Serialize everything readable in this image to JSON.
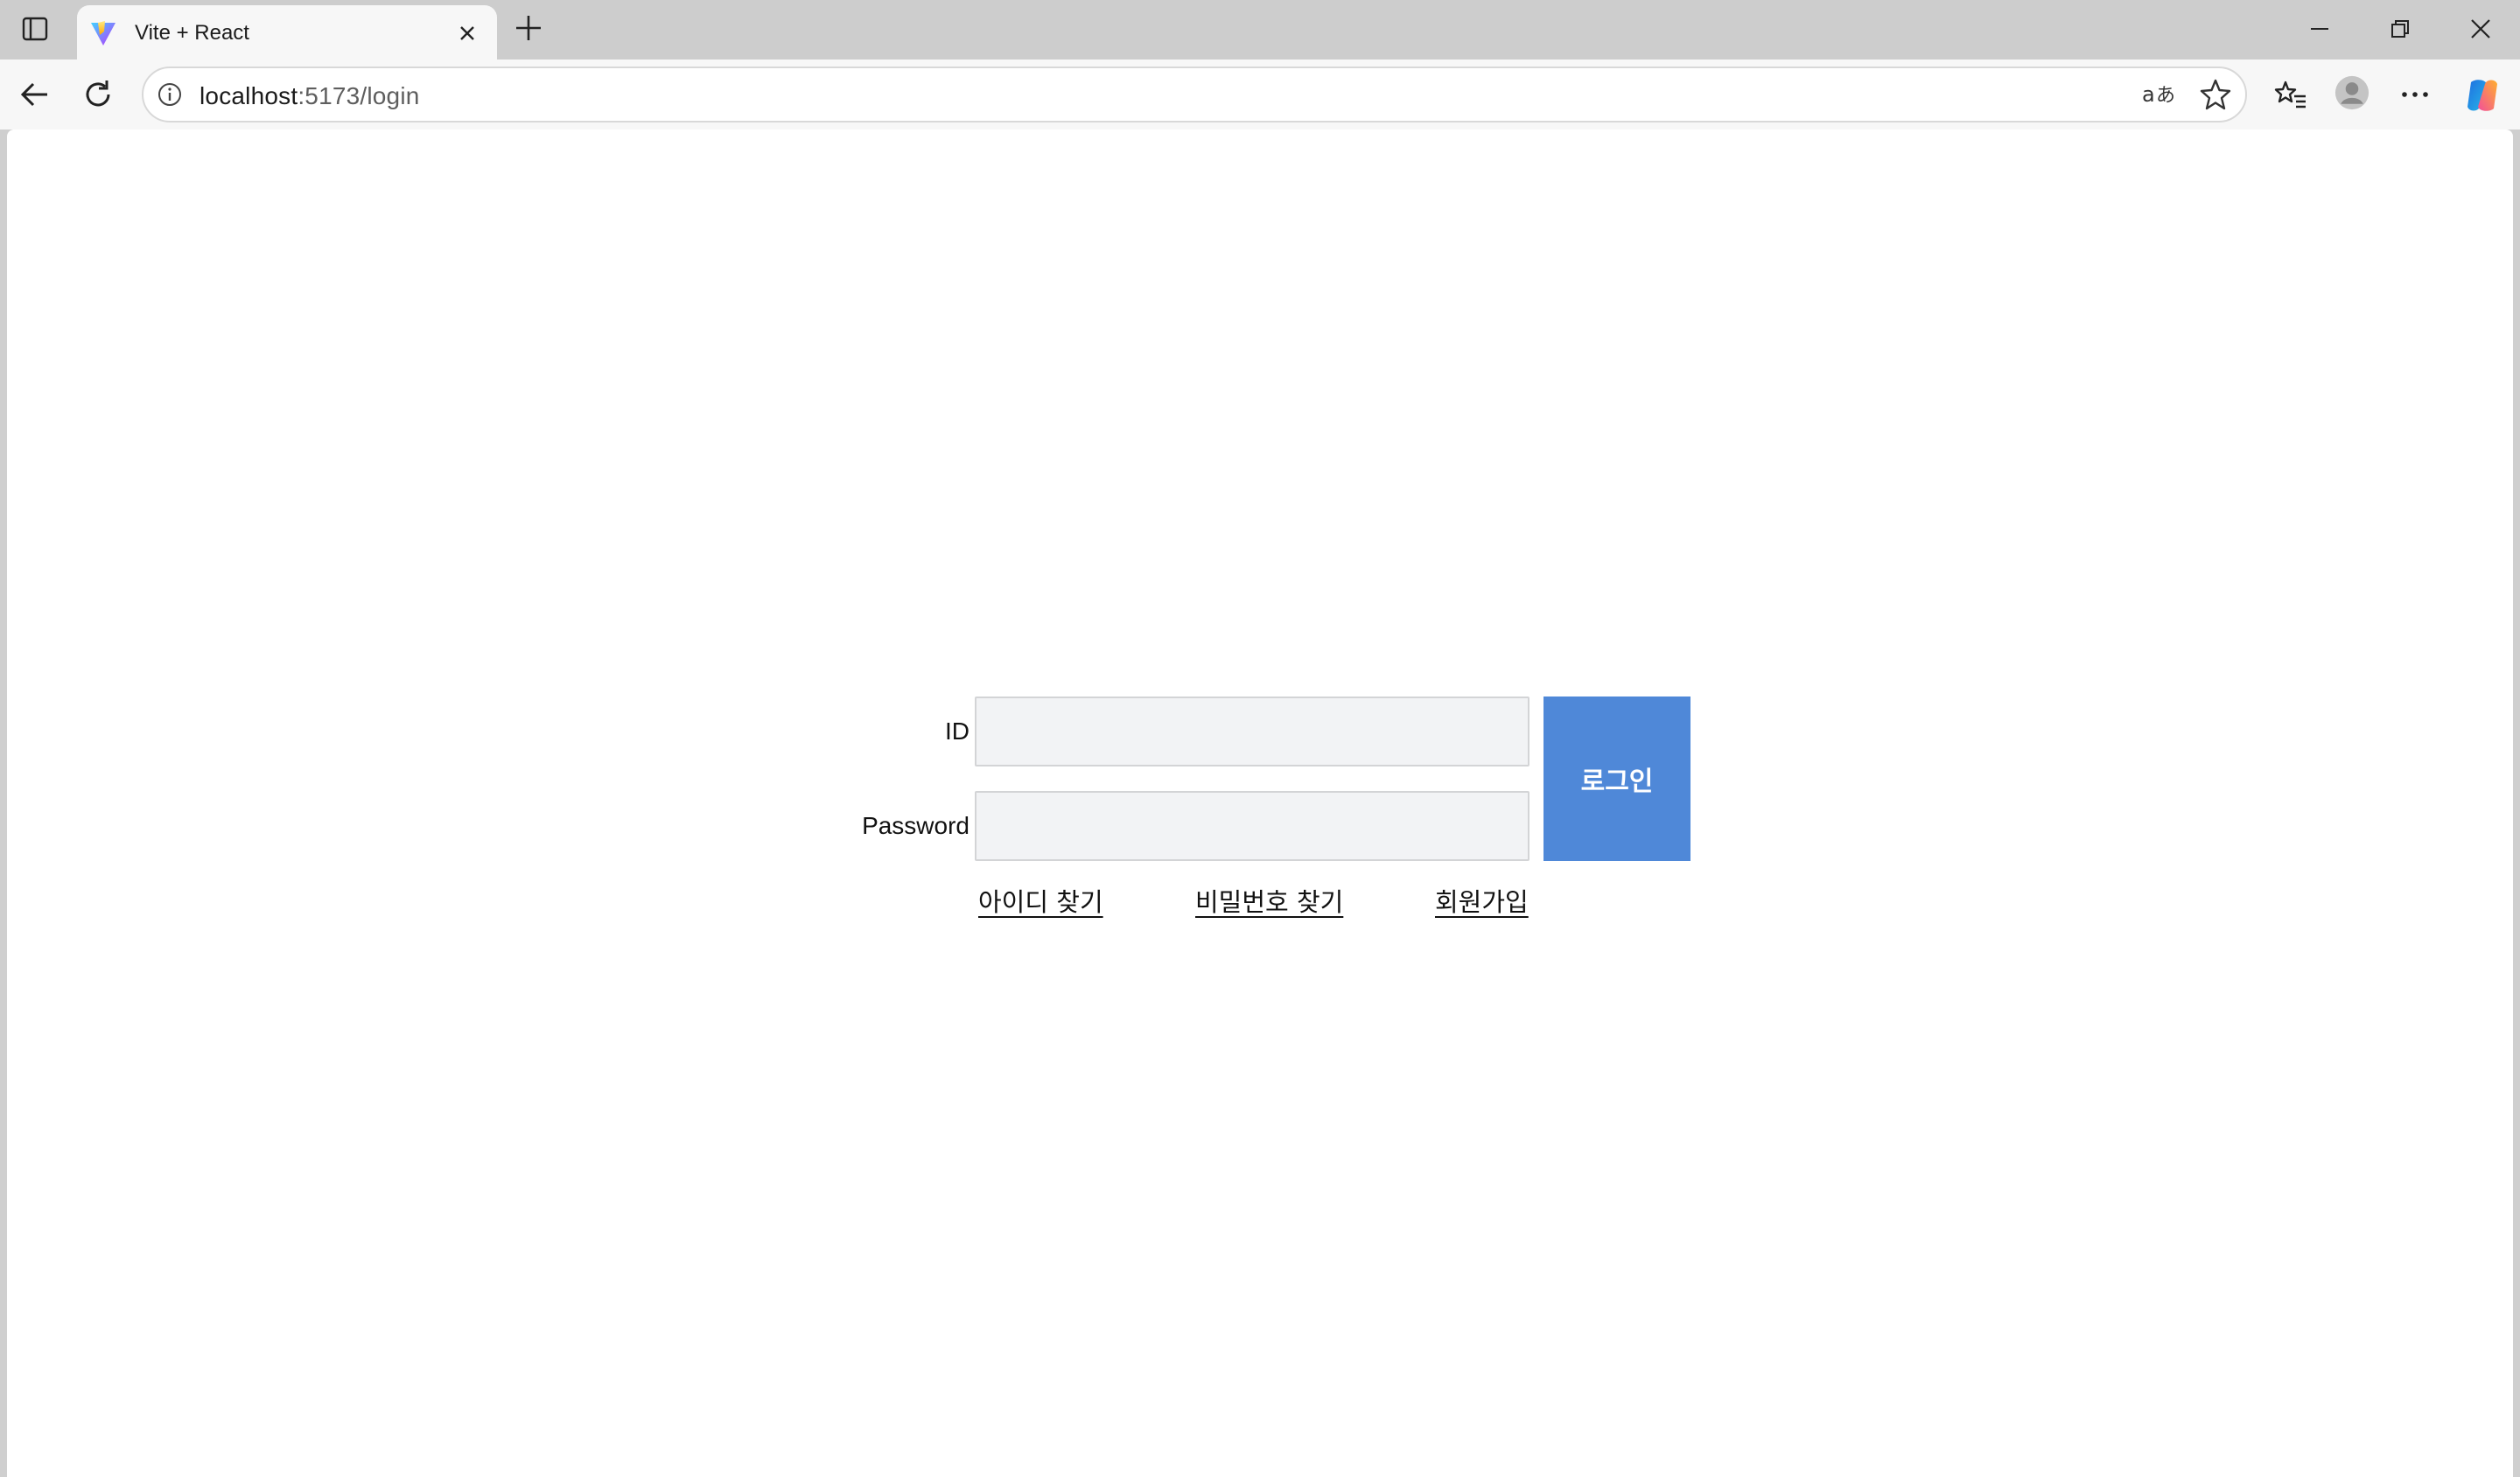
{
  "browser": {
    "tab": {
      "title": "Vite + React",
      "favicon": "vite-logo-icon"
    },
    "address_bar": {
      "host": "localhost",
      "path": ":5173/login"
    },
    "icons": {
      "tab_actions": "tab-actions-icon",
      "close_tab": "close-icon",
      "new_tab": "plus-icon",
      "minimize": "minimize-icon",
      "restore": "restore-icon",
      "close_window": "close-icon",
      "back": "back-arrow-icon",
      "refresh": "refresh-icon",
      "site_info": "info-icon",
      "read_aloud": "translate-icon",
      "favorite": "star-icon",
      "favorites_list": "favorites-icon",
      "profile": "profile-avatar-icon",
      "more": "more-icon",
      "copilot": "copilot-icon"
    }
  },
  "login": {
    "id_label": "ID",
    "password_label": "Password",
    "id_value": "",
    "password_value": "",
    "submit_label": "로그인",
    "links": {
      "find_id": "아이디 찾기",
      "find_password": "비밀번호 찾기",
      "signup": "회원가입"
    },
    "button_color": "#4f88d8"
  }
}
